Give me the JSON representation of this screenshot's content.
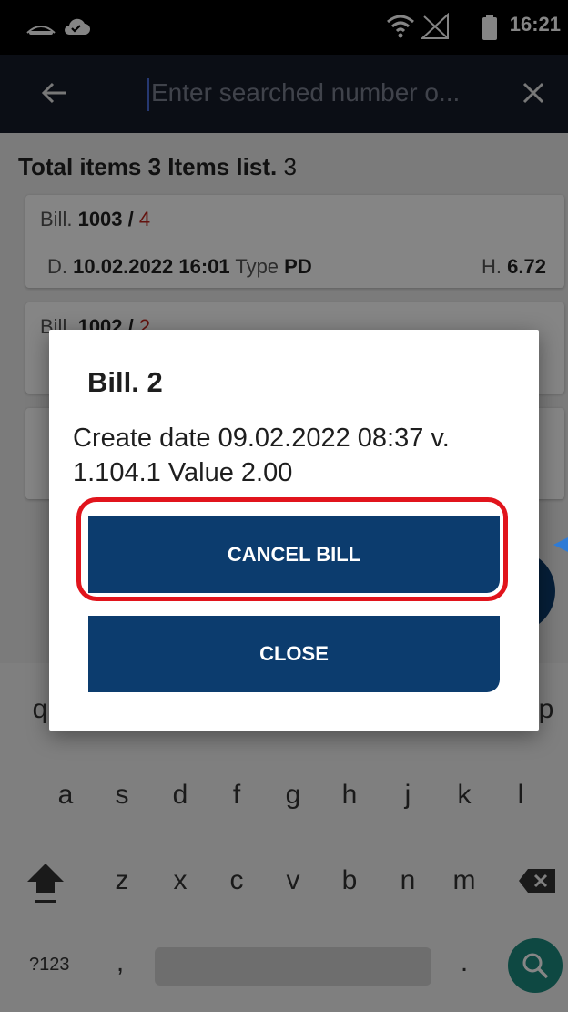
{
  "status_bar": {
    "time": "16:21",
    "icons": [
      "cast-icon",
      "cloud-icon",
      "wifi-icon",
      "no-signal-icon",
      "battery-icon"
    ]
  },
  "search": {
    "placeholder": "Enter searched number o...",
    "back_icon": "arrow-left-icon",
    "clear_icon": "close-icon"
  },
  "list": {
    "total_label": "Total items",
    "total_count": "3",
    "list_label": "Items list.",
    "list_count": "3",
    "items": [
      {
        "bill_label": "Bill.",
        "bill_number": "1003 /",
        "bill_version": "4",
        "date_label": "D.",
        "date": "10.02.2022 16:01",
        "type_label": "Type",
        "type": "PD",
        "value_label": "H.",
        "value": "6.72"
      },
      {
        "bill_label": "Bill.",
        "bill_number": "1002 /",
        "bill_version": "2"
      }
    ]
  },
  "dialog": {
    "title": "Bill. 2",
    "message": "Create date 09.02.2022 08:37 v. 1.104.1 Value 2.00",
    "cancel_label": "CANCEL BILL",
    "close_label": "CLOSE"
  },
  "keyboard": {
    "row2": [
      "a",
      "s",
      "d",
      "f",
      "g",
      "h",
      "j",
      "k",
      "l"
    ],
    "row3": [
      "z",
      "x",
      "c",
      "v",
      "b",
      "n",
      "m"
    ],
    "row1_visible": [
      "q",
      "p"
    ],
    "symbols_label": "?123",
    "comma": ",",
    "period": "."
  },
  "colors": {
    "primary": "#0c3c6e",
    "toolbar": "#161b29",
    "highlight": "#e1141c",
    "accent_red": "#c0261d",
    "kb_search": "#1b8a7f"
  }
}
